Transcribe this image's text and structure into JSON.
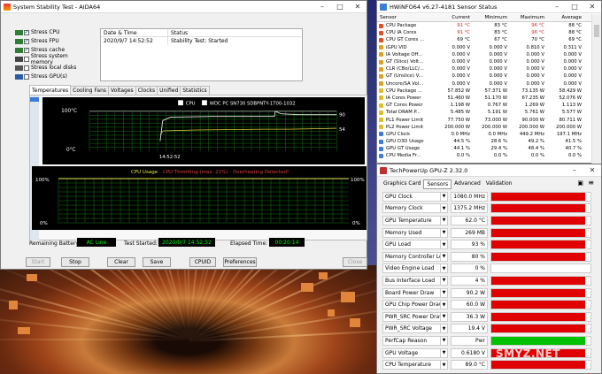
{
  "aida": {
    "title": "System Stability Test - AIDA64",
    "stress": [
      {
        "label": "Stress CPU",
        "checked": true
      },
      {
        "label": "Stress FPU",
        "checked": true
      },
      {
        "label": "Stress cache",
        "checked": true
      },
      {
        "label": "Stress system memory",
        "checked": false
      },
      {
        "label": "Stress local disks",
        "checked": false
      },
      {
        "label": "Stress GPU(s)",
        "checked": false
      }
    ],
    "table": {
      "h1": "Date & Time",
      "h2": "Status",
      "r1c1": "2020/9/7 14:52:52",
      "r1c2": "Stability Test: Started"
    },
    "tabs": [
      "Temperatures",
      "Cooling Fans",
      "Voltages",
      "Clocks",
      "Unified",
      "Statistics"
    ],
    "temp_graph": {
      "legend_cpu": "CPU",
      "legend_ssd": "WDC PC SN730 SDBPNTY-1T00-1032",
      "ymax": "100°C",
      "ymin": "0°C",
      "time": "14:52:52",
      "val1": "90",
      "val2": "54"
    },
    "cpu_graph": {
      "title": "CPU Usage",
      "throttle": "CPU Throttling (max: 21%) - Overheating Detected!",
      "ymax_left": "100%",
      "ymin_left": "0%",
      "ymax_right": "100%",
      "ymin_right": "0%"
    },
    "battery_label": "Remaining Battery:",
    "battery_value": "AC Line",
    "started_label": "Test Started:",
    "started_value": "2020/9/7 14:52:52",
    "elapsed_label": "Elapsed Time:",
    "elapsed_value": "00:20:14",
    "buttons": {
      "start": "Start",
      "stop": "Stop",
      "clear": "Clear",
      "save": "Save",
      "cpuid": "CPUID",
      "preferences": "Preferences",
      "close": "Close"
    }
  },
  "hwinfo": {
    "title": "HWiNFO64 v6.27-4181 Sensor Status",
    "headers": [
      "Sensor",
      "Current",
      "Minimum",
      "Maximum",
      "Average"
    ],
    "rows": [
      [
        "CPU Package",
        "91 °C",
        "83 °C",
        "96 °C",
        "88 °C"
      ],
      [
        "CPU IA Cores",
        "91 °C",
        "83 °C",
        "96 °C",
        "88 °C"
      ],
      [
        "CPU GT Cores ...",
        "69 °C",
        "67 °C",
        "70 °C",
        "69 °C"
      ],
      [
        "iGPU VID",
        "0.000 V",
        "0.000 V",
        "0.810 V",
        "0.311 V"
      ],
      [
        "IA Voltage Off...",
        "0.000 V",
        "0.000 V",
        "0.000 V",
        "0.000 V"
      ],
      [
        "GT (Slice) Volt...",
        "0.000 V",
        "0.000 V",
        "0.000 V",
        "0.000 V"
      ],
      [
        "CLR (CBo/LLC/...",
        "0.000 V",
        "0.000 V",
        "0.000 V",
        "0.000 V"
      ],
      [
        "GT (Unslice) V...",
        "0.000 V",
        "0.000 V",
        "0.000 V",
        "0.000 V"
      ],
      [
        "Uncore/SA Vol...",
        "0.000 V",
        "0.000 V",
        "0.000 V",
        "0.000 V"
      ],
      [
        "CPU Package ...",
        "57.852 W",
        "57.371 W",
        "73.135 W",
        "58.429 W"
      ],
      [
        "IA Cores Power",
        "51.460 W",
        "51.170 W",
        "67.235 W",
        "52.076 W"
      ],
      [
        "GT Cores Power",
        "1.198 W",
        "0.767 W",
        "1.269 W",
        "1.113 W"
      ],
      [
        "Total DRAM P...",
        "5.485 W",
        "5.191 W",
        "5.761 W",
        "5.577 W"
      ],
      [
        "PL1 Power Limit",
        "77.750 W",
        "73.000 W",
        "90.000 W",
        "80.711 W"
      ],
      [
        "PL2 Power Limit",
        "200.000 W",
        "200.000 W",
        "200.000 W",
        "200.000 W"
      ],
      [
        "GPU Clock",
        "0.0 MHz",
        "0.0 MHz",
        "449.2 MHz",
        "197.1 MHz"
      ],
      [
        "GPU D3D Usage",
        "44.5 %",
        "28.6 %",
        "49.2 %",
        "41.5 %"
      ],
      [
        "GPU GT Usage",
        "44.1 %",
        "29.4 %",
        "48.4 %",
        "40.7 %"
      ],
      [
        "CPU Media Fr...",
        "0.0 %",
        "0.0 %",
        "0.0 %",
        "0.0 %"
      ]
    ]
  },
  "gpuz": {
    "title": "TechPowerUp GPU-Z 2.32.0",
    "tabs": [
      "Graphics Card",
      "Sensors",
      "Advanced",
      "Validation"
    ],
    "sensors": [
      {
        "label": "GPU Clock",
        "value": "1080.0 MHz",
        "fill": 0.95,
        "color": "#e00000"
      },
      {
        "label": "Memory Clock",
        "value": "1375.2 MHz",
        "fill": 0.95,
        "color": "#e00000"
      },
      {
        "label": "GPU Temperature",
        "value": "62.0 °C",
        "fill": 0.95,
        "color": "#e00000"
      },
      {
        "label": "Memory Used",
        "value": "269 MB",
        "fill": 0.95,
        "color": "#e00000"
      },
      {
        "label": "GPU Load",
        "value": "93 %",
        "fill": 0.95,
        "color": "#e00000"
      },
      {
        "label": "Memory Controller Load",
        "value": "80 %",
        "fill": 0.95,
        "color": "#e00000"
      },
      {
        "label": "Video Engine Load",
        "value": "0 %",
        "fill": 0,
        "color": "#e00000"
      },
      {
        "label": "Bus Interface Load",
        "value": "4 %",
        "fill": 0.95,
        "color": "#e00000"
      },
      {
        "label": "Board Power Draw",
        "value": "90.2 W",
        "fill": 0.95,
        "color": "#e00000"
      },
      {
        "label": "GPU Chip Power Draw",
        "value": "60.0 W",
        "fill": 0.95,
        "color": "#e00000"
      },
      {
        "label": "PWR_SRC Power Draw",
        "value": "36.3 W",
        "fill": 0.95,
        "color": "#e00000"
      },
      {
        "label": "PWR_SRC Voltage",
        "value": "19.4 V",
        "fill": 0.95,
        "color": "#e00000"
      },
      {
        "label": "PerfCap Reason",
        "value": "Pwr",
        "fill": 0.95,
        "color": "#00c000"
      },
      {
        "label": "GPU Voltage",
        "value": "0.6180 V",
        "fill": 0.95,
        "color": "#e00000"
      },
      {
        "label": "CPU Temperature",
        "value": "89.0 °C",
        "fill": 0.95,
        "color": "#e00000"
      }
    ]
  },
  "watermark": "SMYZ.NET"
}
